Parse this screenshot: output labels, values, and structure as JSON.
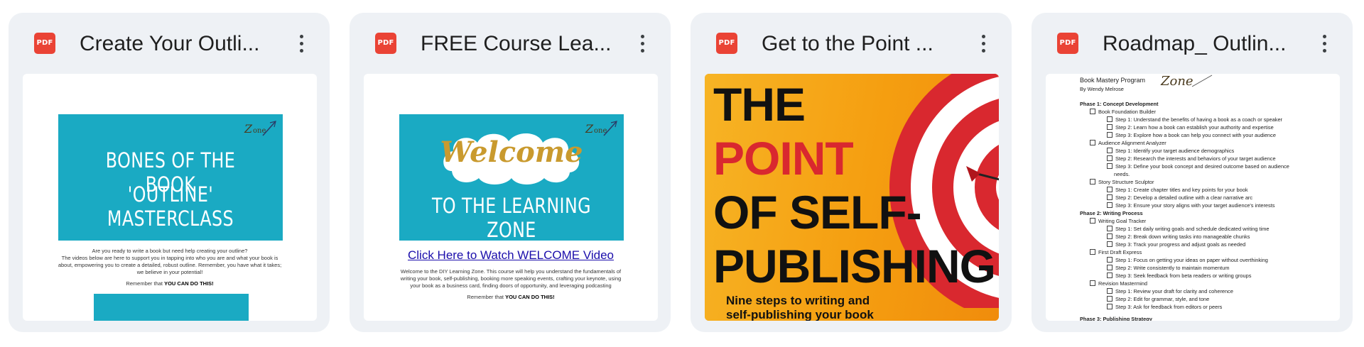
{
  "cards": [
    {
      "title": "Create Your Outli...",
      "file_type": "PDF",
      "preview": {
        "banner_lines": [
          "BONES OF THE BOOK",
          "'OUTLINE' MASTERCLASS"
        ],
        "body": [
          "Are you ready to write a book but need help creating your outline?",
          "The videos below are here to support you in tapping into who you are and what your book is",
          "about, empowering you to create a detailed, robust outline. Remember, you have what it takes;",
          "we believe in your potential!"
        ],
        "closing_prefix": "Remember that ",
        "closing_bold": "YOU CAN DO THIS!"
      }
    },
    {
      "title": "FREE Course Lea...",
      "file_type": "PDF",
      "preview": {
        "welcome_word": "Welcome",
        "banner_line": "TO THE LEARNING ZONE",
        "link_text": "Click Here to Watch WELCOME Video",
        "body": [
          "Welcome to the DIY Learning Zone. This course will help you understand the fundamentals of",
          "writing your book, self-publishing, booking more speaking events, crafting your keynote, using",
          "your book as a business card, finding doors of opportunity, and leveraging podcasting"
        ],
        "closing_prefix": "Remember that ",
        "closing_bold": "YOU CAN DO THIS!"
      }
    },
    {
      "title": "Get to the Point ...",
      "file_type": "PDF",
      "preview": {
        "headline": [
          "THE",
          "POINT",
          "OF SELF-",
          "PUBLISHING"
        ],
        "subline": [
          "Nine steps to writing and",
          "self-publishing your book"
        ]
      }
    },
    {
      "title": "Roadmap_ Outlin...",
      "file_type": "PDF",
      "preview": {
        "program": "Book Mastery Program",
        "author": "By Wendy Melrose",
        "lines": [
          {
            "kind": "phase",
            "text": "Phase 1: Concept Development"
          },
          {
            "kind": "item",
            "text": "Book Foundation Builder"
          },
          {
            "kind": "step",
            "text": "Step 1: Understand the benefits of having a book as a coach or speaker"
          },
          {
            "kind": "step",
            "text": "Step 2: Learn how a book can establish your authority and expertise"
          },
          {
            "kind": "step",
            "text": "Step 3: Explore how a book can help you connect with your audience"
          },
          {
            "kind": "item",
            "text": "Audience Alignment Analyzer"
          },
          {
            "kind": "step",
            "text": "Step 1: Identify your target audience demographics"
          },
          {
            "kind": "step",
            "text": "Step 2: Research the interests and behaviors of your target audience"
          },
          {
            "kind": "step",
            "text": "Step 3: Define your book concept and desired outcome based on audience"
          },
          {
            "kind": "cont",
            "text": "needs."
          },
          {
            "kind": "item",
            "text": "Story Structure Sculptor"
          },
          {
            "kind": "step",
            "text": "Step 1: Create chapter titles and key points for your book"
          },
          {
            "kind": "step",
            "text": "Step 2: Develop a detailed outline with a clear narrative arc"
          },
          {
            "kind": "step",
            "text": "Step 3: Ensure your story aligns with your target audience's interests"
          },
          {
            "kind": "phase",
            "text": "Phase 2: Writing Process"
          },
          {
            "kind": "item",
            "text": "Writing Goal Tracker"
          },
          {
            "kind": "step",
            "text": "Step 1: Set daily writing goals and schedule dedicated writing time"
          },
          {
            "kind": "step",
            "text": "Step 2: Break down writing tasks into manageable chunks"
          },
          {
            "kind": "step",
            "text": "Step 3: Track your progress and adjust goals as needed"
          },
          {
            "kind": "item",
            "text": "First Draft Express"
          },
          {
            "kind": "step",
            "text": "Step 1: Focus on getting your ideas on paper without overthinking"
          },
          {
            "kind": "step",
            "text": "Step 2: Write consistently to maintain momentum"
          },
          {
            "kind": "step",
            "text": "Step 3: Seek feedback from beta readers or writing groups"
          },
          {
            "kind": "item",
            "text": "Revision Mastermind"
          },
          {
            "kind": "step",
            "text": "Step 1: Review your draft for clarity and coherence"
          },
          {
            "kind": "step",
            "text": "Step 2: Edit for grammar, style, and tone"
          },
          {
            "kind": "step",
            "text": "Step 3: Ask for feedback from editors or peers"
          },
          {
            "kind": "gap",
            "text": ""
          },
          {
            "kind": "phase",
            "text": "Phase 3: Publishing Strategy"
          }
        ]
      }
    }
  ],
  "colors": {
    "card_bg": "#eef1f5",
    "pdf_red": "#ea4335",
    "teal": "#1aaac3",
    "link_blue": "#1a0dab",
    "accent_red": "#d9282f"
  },
  "icons": {
    "file_icon": "pdf-icon",
    "menu_icon": "more-vert-icon"
  }
}
